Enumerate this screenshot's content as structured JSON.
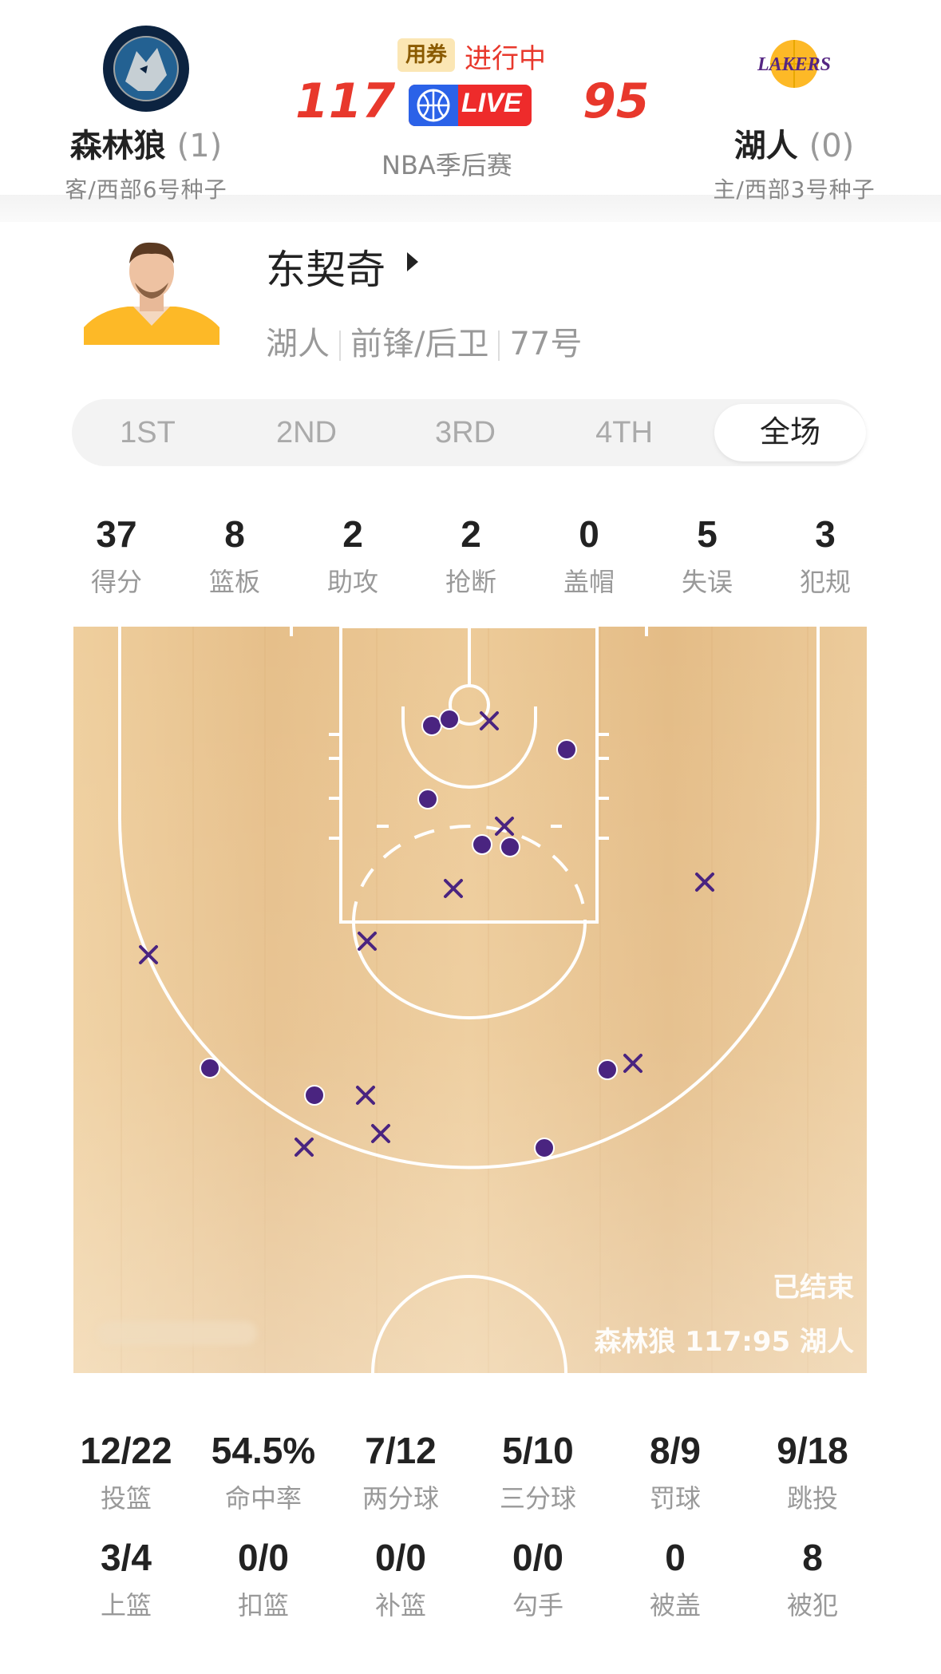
{
  "header": {
    "away_team": {
      "name": "森林狼",
      "wins": "(1)",
      "seed": "客/西部6号种子",
      "logo_text": "MINNESOTA TIMBERWOLVES",
      "color": "#0c2340"
    },
    "home_team": {
      "name": "湖人",
      "wins": "(0)",
      "seed": "主/西部3号种子",
      "logo_text": "LAKERS",
      "color": "#552583"
    },
    "coupon_label": "用券",
    "status": "进行中",
    "away_score": "117",
    "home_score": "95",
    "live_label": "LIVE",
    "league": "NBA季后赛"
  },
  "player": {
    "name": "东契奇",
    "team": "湖人",
    "position": "前锋/后卫",
    "number": "77号"
  },
  "tabs": [
    {
      "label": "1ST",
      "active": false
    },
    {
      "label": "2ND",
      "active": false
    },
    {
      "label": "3RD",
      "active": false
    },
    {
      "label": "4TH",
      "active": false
    },
    {
      "label": "全场",
      "active": true
    }
  ],
  "stats": [
    {
      "value": "37",
      "label": "得分"
    },
    {
      "value": "8",
      "label": "篮板"
    },
    {
      "value": "2",
      "label": "助攻"
    },
    {
      "value": "2",
      "label": "抢断"
    },
    {
      "value": "0",
      "label": "盖帽"
    },
    {
      "value": "5",
      "label": "失误"
    },
    {
      "value": "3",
      "label": "犯规"
    }
  ],
  "court": {
    "status": "已结束",
    "score_line": "森林狼 117:95 湖人",
    "made_color": "#4a2480",
    "missed_color": "#4a2480",
    "floor_color": "#eac898"
  },
  "shooting_row1": [
    {
      "value": "12/22",
      "label": "投篮"
    },
    {
      "value": "54.5%",
      "label": "命中率"
    },
    {
      "value": "7/12",
      "label": "两分球"
    },
    {
      "value": "5/10",
      "label": "三分球"
    },
    {
      "value": "8/9",
      "label": "罚球"
    },
    {
      "value": "9/18",
      "label": "跳投"
    }
  ],
  "shooting_row2": [
    {
      "value": "3/4",
      "label": "上篮"
    },
    {
      "value": "0/0",
      "label": "扣篮"
    },
    {
      "value": "0/0",
      "label": "补篮"
    },
    {
      "value": "0/0",
      "label": "勾手"
    },
    {
      "value": "0",
      "label": "被盖"
    },
    {
      "value": "8",
      "label": "被犯"
    }
  ]
}
